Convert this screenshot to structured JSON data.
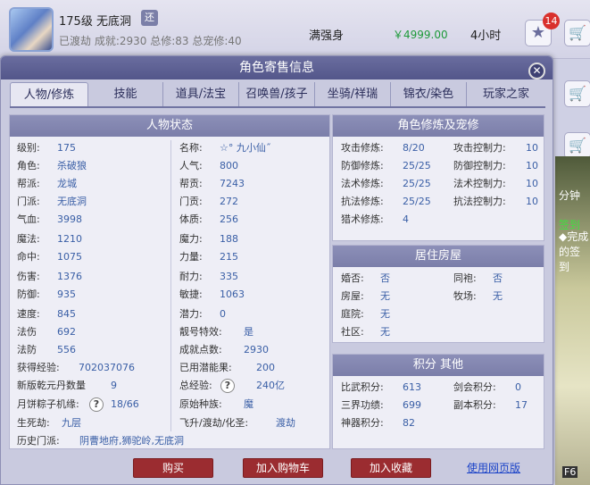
{
  "background_row": {
    "level": "175级",
    "name": "无底洞",
    "tag": "还",
    "sub": "已渡劫 成就:2930 总修:83 总宠修:40",
    "desc": "满强身",
    "price": "￥4999.00",
    "time": "4小时",
    "star_badge": "14"
  },
  "game_side": {
    "t1": "分钟",
    "t2": "签到",
    "t3": "◆完成\n的签到",
    "key": "F6"
  },
  "modal": {
    "title": "角色寄售信息",
    "close": "✕",
    "tabs": [
      "人物/修炼",
      "技能",
      "道具/法宝",
      "召唤兽/孩子",
      "坐骑/祥瑞",
      "锦衣/染色",
      "玩家之家"
    ]
  },
  "status": {
    "title": "人物状态",
    "left": [
      {
        "label": "级别:",
        "value": "175"
      },
      {
        "label": "角色:",
        "value": "杀破狼"
      },
      {
        "label": "帮派:",
        "value": "龙城"
      },
      {
        "label": "门派:",
        "value": "无底洞"
      },
      {
        "label": "气血:",
        "value": "3998"
      },
      {
        "label": "魔法:",
        "value": "1210"
      },
      {
        "label": "命中:",
        "value": "1075"
      },
      {
        "label": "伤害:",
        "value": "1376"
      },
      {
        "label": "防御:",
        "value": "935"
      },
      {
        "label": "速度:",
        "value": "845"
      },
      {
        "label": "法伤",
        "value": "692"
      },
      {
        "label": "法防",
        "value": "556"
      },
      {
        "label": "获得经验:",
        "value": "702037076"
      },
      {
        "label": "新版乾元丹数量",
        "value": "9"
      },
      {
        "label": "月饼粽子机缘:",
        "value": "18/66"
      },
      {
        "label": "生死劫:",
        "value": "九层"
      }
    ],
    "right": [
      {
        "label": "名称:",
        "value": "☆° 九小仙˝"
      },
      {
        "label": "人气:",
        "value": "800"
      },
      {
        "label": "帮贡:",
        "value": "7243"
      },
      {
        "label": "门贡:",
        "value": "272"
      },
      {
        "label": "体质:",
        "value": "256"
      },
      {
        "label": "魔力:",
        "value": "188"
      },
      {
        "label": "力量:",
        "value": "215"
      },
      {
        "label": "耐力:",
        "value": "335"
      },
      {
        "label": "敏捷:",
        "value": "1063"
      },
      {
        "label": "潜力:",
        "value": "0"
      },
      {
        "label": "靓号特效:",
        "value": "是"
      },
      {
        "label": "成就点数:",
        "value": "2930"
      },
      {
        "label": "已用潜能果:",
        "value": "200"
      },
      {
        "label": "总经验:",
        "value": "240亿"
      },
      {
        "label": "原始种族:",
        "value": "魔"
      },
      {
        "label": "飞升/渡劫/化圣:",
        "value": "渡劫"
      }
    ],
    "history_label": "历史门派:",
    "history_value": "阴曹地府,狮驼岭,无底洞"
  },
  "cultivation": {
    "title": "角色修炼及宠修",
    "rows": [
      {
        "l1": "攻击修炼:",
        "v1": "8/20",
        "l2": "攻击控制力:",
        "v2": "10"
      },
      {
        "l1": "防御修炼:",
        "v1": "25/25",
        "l2": "防御控制力:",
        "v2": "10"
      },
      {
        "l1": "法术修炼:",
        "v1": "25/25",
        "l2": "法术控制力:",
        "v2": "10"
      },
      {
        "l1": "抗法修炼:",
        "v1": "25/25",
        "l2": "抗法控制力:",
        "v2": "10"
      },
      {
        "l1": "猎术修炼:",
        "v1": "4",
        "l2": "",
        "v2": ""
      }
    ]
  },
  "housing": {
    "title": "居住房屋",
    "rows": [
      {
        "l1": "婚否:",
        "v1": "否",
        "l2": "同袍:",
        "v2": "否"
      },
      {
        "l1": "房屋:",
        "v1": "无",
        "l2": "牧场:",
        "v2": "无"
      },
      {
        "l1": "庭院:",
        "v1": "无",
        "l2": "",
        "v2": ""
      },
      {
        "l1": "社区:",
        "v1": "无",
        "l2": "",
        "v2": ""
      }
    ]
  },
  "points": {
    "title": "积分 其他",
    "rows": [
      {
        "l1": "比武积分:",
        "v1": "613",
        "l2": "剑会积分:",
        "v2": "0"
      },
      {
        "l1": "三界功绩:",
        "v1": "699",
        "l2": "副本积分:",
        "v2": "17"
      },
      {
        "l1": "神器积分:",
        "v1": "82",
        "l2": "",
        "v2": ""
      }
    ]
  },
  "actions": {
    "buy": "购买",
    "cart": "加入购物车",
    "favorite": "加入收藏",
    "web": "使用网页版"
  },
  "colors": {
    "accent": "#53568a",
    "price_green": "#1e9a3a",
    "button_red": "#9b2c30",
    "value_blue": "#3a5fa6"
  }
}
